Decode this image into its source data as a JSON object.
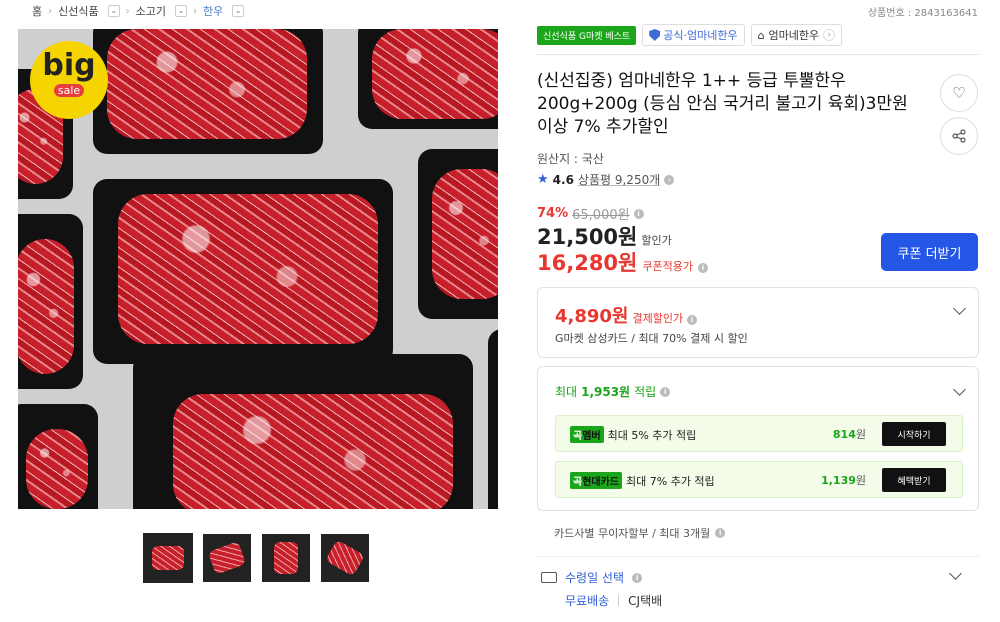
{
  "breadcrumb": {
    "items": [
      {
        "label": "홈"
      },
      {
        "label": "신선식품"
      },
      {
        "label": "소고기"
      },
      {
        "label": "한우"
      }
    ]
  },
  "product_no": "상품번호 : 2843163641",
  "image": {
    "badge_big": "big",
    "badge_sale": "sale",
    "thumbnail_count": 4
  },
  "tags": {
    "best": "신선식품 G마켓 베스트",
    "official": "공식·엄마네한우",
    "store": "엄마네한우"
  },
  "title": "(신선집중) 엄마네한우 1++ 등급 투뿔한우 200g+200g (등심 안심 국거리 불고기 육회)3만원 이상 7% 추가할인",
  "origin": "원산지 : 국산",
  "rating": {
    "score": "4.6",
    "reviews": "상품평 9,250개"
  },
  "price": {
    "discount_pct": "74%",
    "original": "65,000원",
    "sale": "21,500원",
    "sale_label": "할인가",
    "coupon": "16,280원",
    "coupon_label": "쿠폰적용가",
    "coupon_button": "쿠폰 더받기"
  },
  "payment": {
    "amount": "4,890원",
    "label": "결제할인가",
    "desc": "G마켓 삼성카드 / 최대 70% 결제 시 할인"
  },
  "points": {
    "prefix": "최대",
    "amount": "1,953원",
    "suffix": "적립",
    "rows": [
      {
        "badge_icon": "곡",
        "badge": "멤버",
        "text": "최대 5% 추가 적립",
        "amount": "814",
        "unit": "원",
        "action": "시작하기"
      },
      {
        "badge_icon": "곡",
        "badge": "현대카드",
        "text": "최대 7% 추가 적립",
        "amount": "1,139",
        "unit": "원",
        "action": "혜택받기"
      }
    ]
  },
  "installment": "카드사별 무이자할부 / 최대 3개월",
  "shipping": {
    "label": "수령일 선택",
    "free": "무료배송",
    "carrier": "CJ택배"
  },
  "colors": {
    "accent_blue": "#2457e6",
    "sale_red": "#e8372f",
    "point_green": "#1aa51a"
  }
}
